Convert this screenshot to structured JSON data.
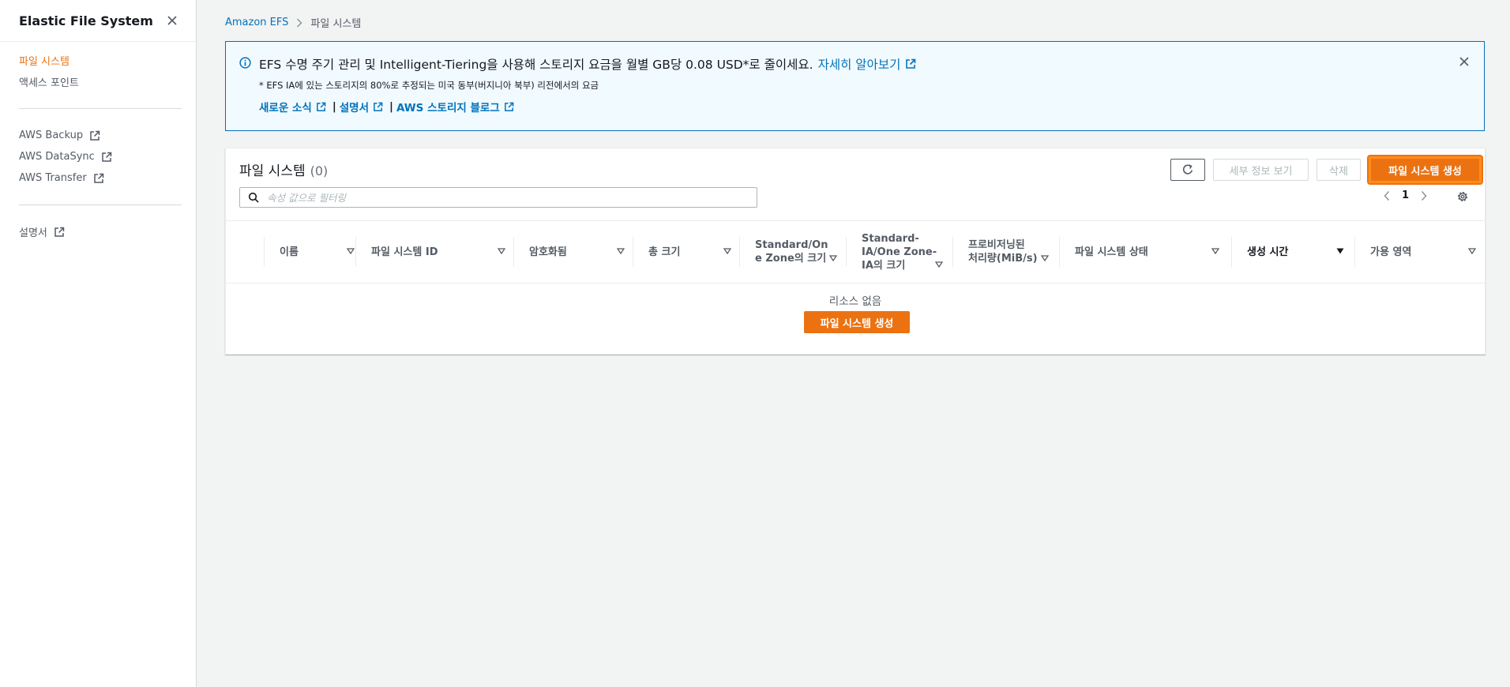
{
  "sidebar": {
    "title": "Elastic File System",
    "nav_primary": [
      "파일 시스템",
      "액세스 포인트"
    ],
    "nav_services": [
      "AWS Backup",
      "AWS DataSync",
      "AWS Transfer"
    ],
    "nav_docs": [
      "설명서"
    ]
  },
  "breadcrumb": {
    "root": "Amazon EFS",
    "current": "파일 시스템"
  },
  "banner": {
    "main_text": "EFS 수명 주기 관리 및 Intelligent-Tiering을 사용해 스토리지 요금을 월별 GB당 0.08 USD*로 줄이세요.",
    "learn_more": "자세히 알아보기",
    "footnote": "* EFS IA에 있는 스토리지의 80%로 추정되는 미국 동부(버지니아 북부) 리전에서의 요금",
    "links": [
      "새로운 소식",
      "설명서",
      "AWS 스토리지 블로그"
    ],
    "separator": "|"
  },
  "table": {
    "title": "파일 시스템",
    "count": "(0)",
    "buttons": {
      "details": "세부 정보 보기",
      "delete": "삭제",
      "create": "파일 시스템 생성"
    },
    "search_placeholder": "속성 값으로 필터링",
    "page": "1",
    "columns": {
      "name": "이름",
      "id": "파일 시스템 ID",
      "encrypted": "암호화됨",
      "size": "총 크기",
      "std_l1": "Standard/On",
      "std_l2": "e Zone의 크기",
      "ia_l1": "Standard-",
      "ia_l2": "IA/One Zone-",
      "ia_l3": "IA의 크기",
      "thr_l1": "프로비저닝된",
      "thr_l2": "처리량(MiB/s)",
      "state": "파일 시스템 상태",
      "created": "생성 시간",
      "az": "가용 영역"
    },
    "empty": "리소스 없음",
    "empty_button": "파일 시스템 생성"
  },
  "colors": {
    "accent": "#ec7211",
    "link": "#0073bb",
    "banner_bg": "#f1faff"
  }
}
